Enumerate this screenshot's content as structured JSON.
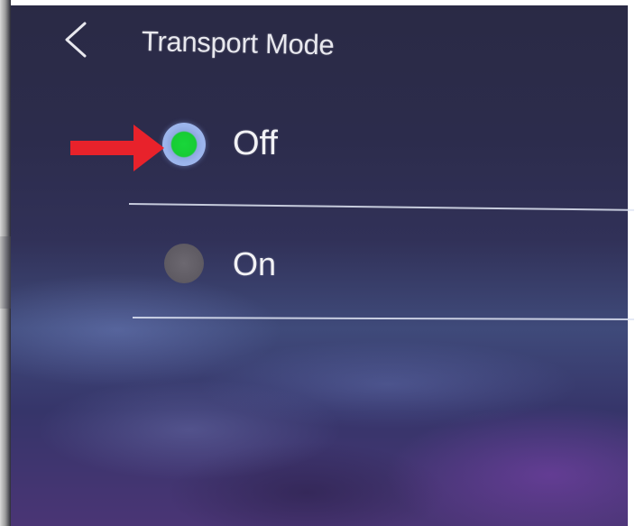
{
  "header": {
    "title": "Transport Mode",
    "back_icon": "chevron-left-icon"
  },
  "options": [
    {
      "label": "Off",
      "selected": true
    },
    {
      "label": "On",
      "selected": false
    }
  ],
  "annotation": {
    "icon": "red-arrow-right-icon",
    "color": "#e8222b"
  },
  "colors": {
    "selected_indicator": "#17cc34",
    "selected_ring": "#9bb4ec",
    "unselected_indicator": "#5e5a62",
    "text": "#f2f2f5"
  }
}
